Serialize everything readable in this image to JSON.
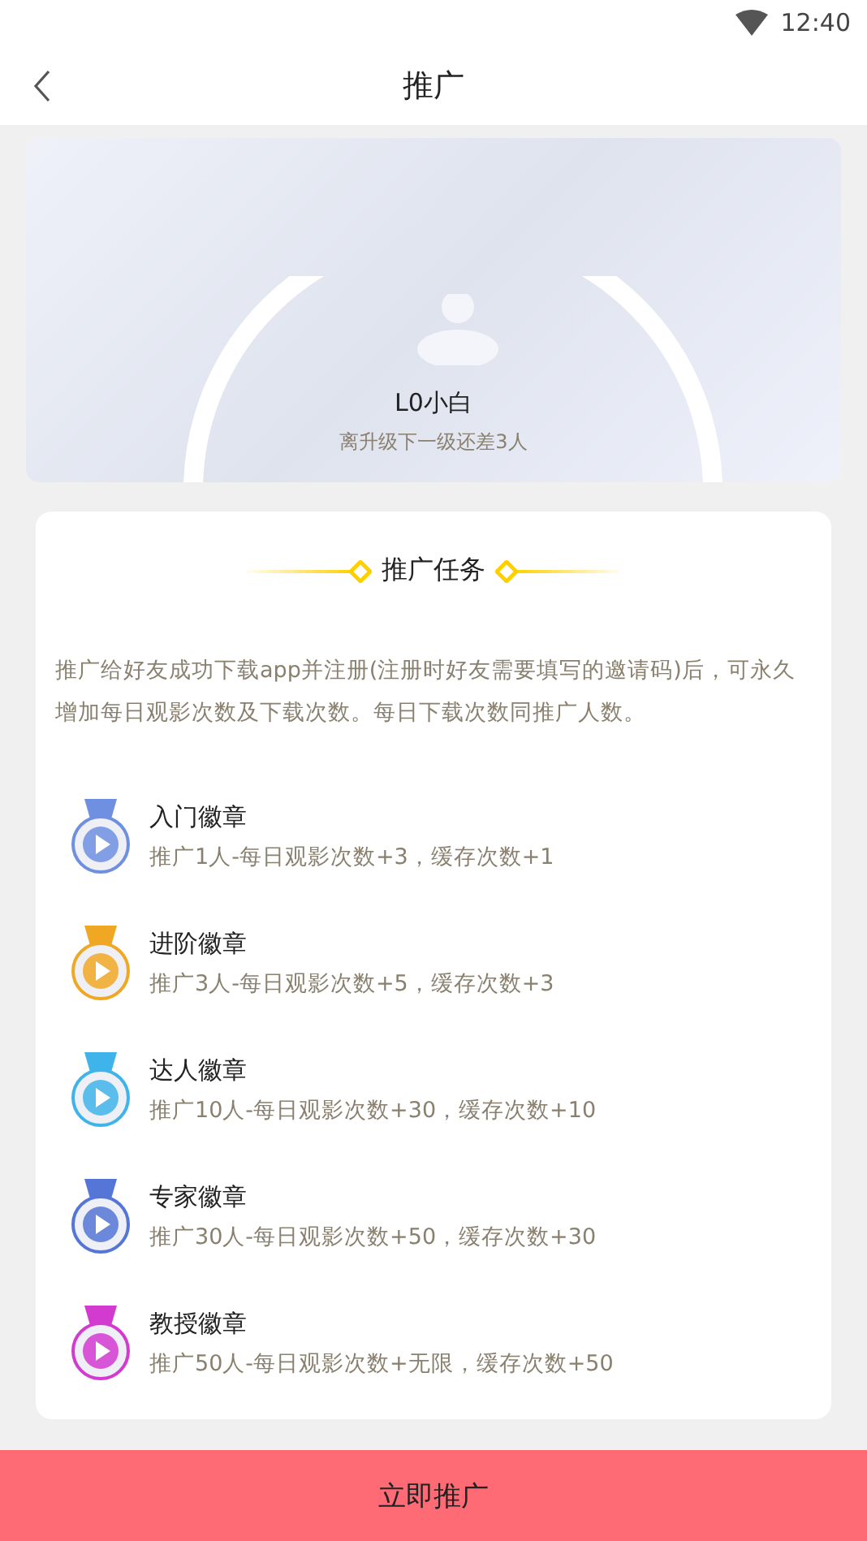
{
  "status_bar": {
    "time": "12:40"
  },
  "nav": {
    "title": "推广"
  },
  "level_card": {
    "level": "L0小白",
    "hint": "离升级下一级还差3人"
  },
  "tasks": {
    "title": "推广任务",
    "description": "推广给好友成功下载app并注册(注册时好友需要填写的邀请码)后，可永久增加每日观影次数及下载次数。每日下载次数同推广人数。",
    "badges": [
      {
        "name": "入门徽章",
        "reward": "推广1人-每日观影次数+3，缓存次数+1",
        "color": "#6f8fe0"
      },
      {
        "name": "进阶徽章",
        "reward": "推广3人-每日观影次数+5，缓存次数+3",
        "color": "#f0a824"
      },
      {
        "name": "达人徽章",
        "reward": "推广10人-每日观影次数+30，缓存次数+10",
        "color": "#3fb4ea"
      },
      {
        "name": "专家徽章",
        "reward": "推广30人-每日观影次数+50，缓存次数+30",
        "color": "#5576d6"
      },
      {
        "name": "教授徽章",
        "reward": "推广50人-每日观影次数+无限，缓存次数+50",
        "color": "#d23ad0"
      }
    ]
  },
  "action_button": "立即推广"
}
